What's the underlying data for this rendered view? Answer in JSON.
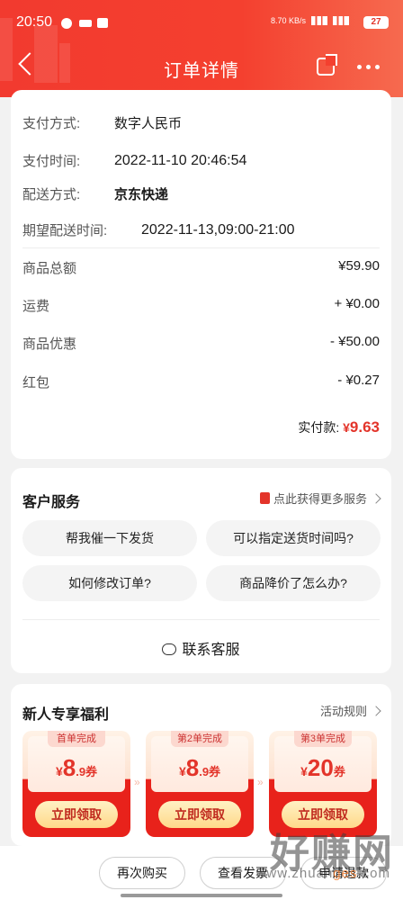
{
  "status_bar": {
    "time": "20:50",
    "network": "8.70 KB/s",
    "battery": "27"
  },
  "header": {
    "title": "订单详情"
  },
  "order_info": {
    "payment_method": {
      "label": "支付方式:",
      "value": "数字人民币"
    },
    "payment_time": {
      "label": "支付时间:",
      "value": "2022-11-10 20:46:54"
    },
    "delivery_method": {
      "label": "配送方式:",
      "value": "京东快递"
    },
    "expected_delivery": {
      "label": "期望配送时间:",
      "value": "2022-11-13,09:00-21:00"
    }
  },
  "amounts": [
    {
      "label": "商品总额",
      "value": "¥59.90"
    },
    {
      "label": "运费",
      "value": "+ ¥0.00"
    },
    {
      "label": "商品优惠",
      "value": "- ¥50.00"
    },
    {
      "label": "红包",
      "value": "- ¥0.27"
    }
  ],
  "actual_payment": {
    "label": "实付款:",
    "currency": "¥",
    "value": "9.63"
  },
  "customer_service": {
    "title": "客户服务",
    "more_link": "点此获得更多服务",
    "questions": [
      "帮我催一下发货",
      "可以指定送货时间吗?",
      "如何修改订单?",
      "商品降价了怎么办?"
    ],
    "contact": "联系客服"
  },
  "new_user": {
    "title": "新人专享福利",
    "rules": "活动规则",
    "coupons": [
      {
        "label": "首单完成",
        "currency": "¥",
        "amount": "8",
        "suffix": ".9券",
        "button": "立即领取"
      },
      {
        "label": "第2单完成",
        "currency": "¥",
        "amount": "8",
        "suffix": ".9券",
        "button": "立即领取"
      },
      {
        "label": "第3单完成",
        "currency": "¥",
        "amount": "20",
        "suffix": "券",
        "button": "立即领取"
      }
    ]
  },
  "bottom_bar": {
    "buy_again": "再次购买",
    "invoice": "查看发票",
    "refund": "申请退款"
  },
  "watermark": {
    "main": "好赚网",
    "sub_1": "www.zhuan",
    "sub_2": "ges",
    "sub_3": ".com"
  },
  "colors": {
    "brand_red": "#f23a2f",
    "price_red": "#e3342a"
  }
}
